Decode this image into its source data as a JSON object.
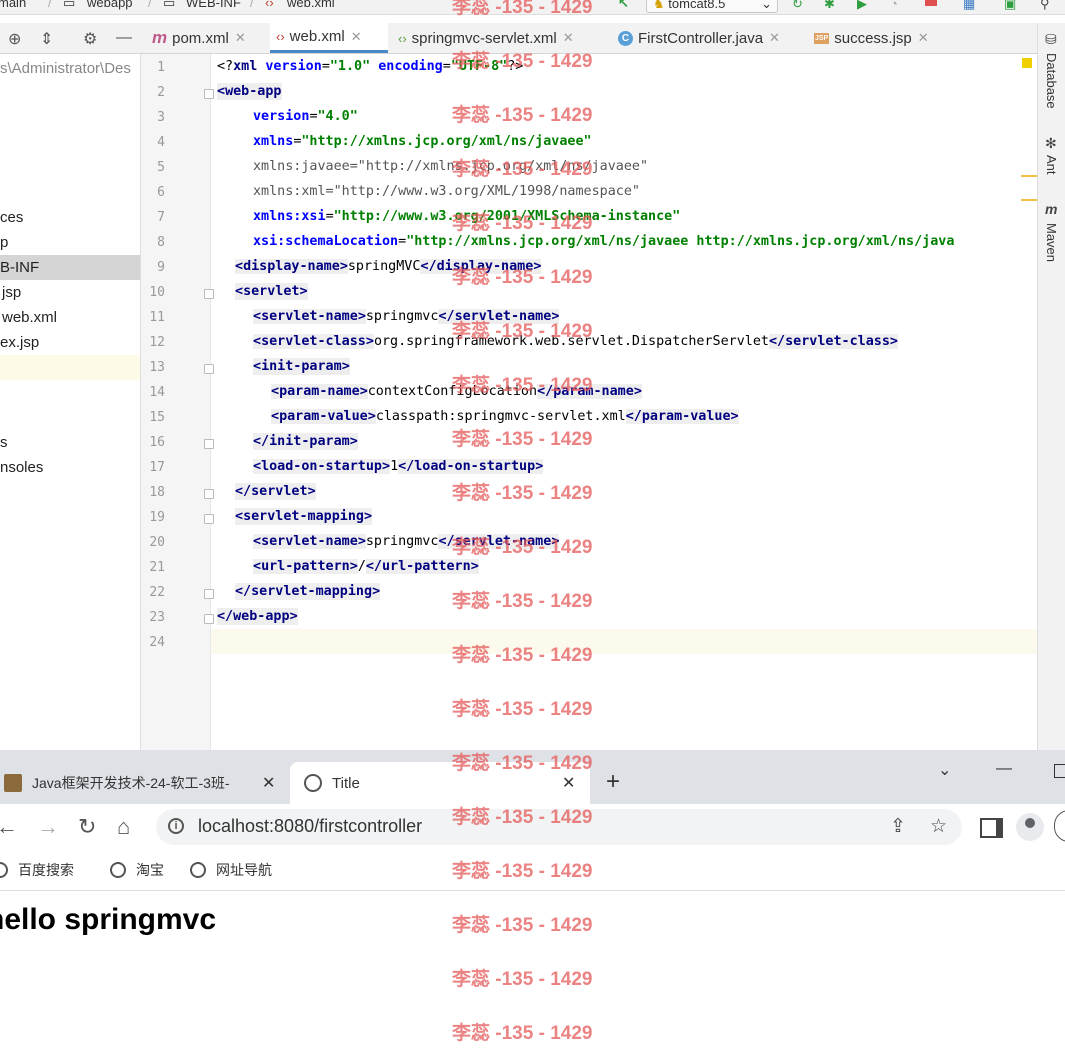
{
  "ide": {
    "breadcrumbs": [
      "main",
      "webapp",
      "WEB-INF",
      "web.xml"
    ],
    "run_config": "tomcat8.5",
    "tabs": [
      {
        "label": "pom.xml",
        "icon": "maven-icon",
        "active": false
      },
      {
        "label": "web.xml",
        "icon": "xml-file-icon",
        "active": true
      },
      {
        "label": "springmvc-servlet.xml",
        "icon": "spring-xml-icon",
        "active": false
      },
      {
        "label": "FirstController.java",
        "icon": "java-class-icon",
        "active": false
      },
      {
        "label": "success.jsp",
        "icon": "jsp-file-icon",
        "active": false
      }
    ],
    "project_tree": {
      "path": "s\\Administrator\\Des",
      "items": [
        "ces",
        "p",
        "B-INF",
        "jsp",
        "web.xml",
        "ex.jsp",
        "",
        "s",
        "nsoles"
      ]
    },
    "right_tools": [
      "Database",
      "Ant",
      "Maven"
    ],
    "line_numbers": [
      "1",
      "2",
      "3",
      "4",
      "5",
      "6",
      "7",
      "8",
      "9",
      "10",
      "11",
      "12",
      "13",
      "14",
      "15",
      "16",
      "17",
      "18",
      "19",
      "20",
      "21",
      "22",
      "23",
      "24"
    ],
    "code": {
      "l1": [
        "<?",
        "xml",
        " ",
        "version",
        "=",
        "\"1.0\"",
        " ",
        "encoding",
        "=",
        "\"UTF-8\"",
        "?>"
      ],
      "l2": [
        "<",
        "web-app"
      ],
      "l3": [
        "version",
        "=",
        "\"4.0\""
      ],
      "l4": [
        "xmlns",
        "=",
        "\"http://xmlns.jcp.org/xml/ns/javaee\""
      ],
      "l5": [
        "xmlns:javaee=\"http://xmlns.jcp.org/xml/ns/javaee\""
      ],
      "l6": [
        "xmlns:xml=\"http://www.w3.org/XML/1998/namespace\""
      ],
      "l7": [
        "xmlns:xsi",
        "=",
        "\"http://www.w3.org/2001/XMLSchema-instance\""
      ],
      "l8": [
        "xsi:schemaLocation",
        "=",
        "\"http://xmlns.jcp.org/xml/ns/javaee http://xmlns.jcp.org/xml/ns/java"
      ],
      "l9": [
        "<",
        "display-name",
        ">",
        "springMVC",
        "</",
        "display-name",
        ">"
      ],
      "l10": [
        "<",
        "servlet",
        ">"
      ],
      "l11": [
        "<",
        "servlet-name",
        ">",
        "springmvc",
        "</",
        "servlet-name",
        ">"
      ],
      "l12": [
        "<",
        "servlet-class",
        ">",
        "org.springframework.web.servlet.DispatcherServlet",
        "</",
        "servlet-class",
        ">"
      ],
      "l13": [
        "<",
        "init-param",
        ">"
      ],
      "l14": [
        "<",
        "param-name",
        ">",
        "contextConfigLocation",
        "</",
        "param-name",
        ">"
      ],
      "l15": [
        "<",
        "param-value",
        ">",
        "classpath:springmvc-servlet.xml",
        "</",
        "param-value",
        ">"
      ],
      "l16": [
        "</",
        "init-param",
        ">"
      ],
      "l17": [
        "<",
        "load-on-startup",
        ">",
        "1",
        "</",
        "load-on-startup",
        ">"
      ],
      "l18": [
        "</",
        "servlet",
        ">"
      ],
      "l19": [
        "<",
        "servlet-mapping",
        ">"
      ],
      "l20": [
        "<",
        "servlet-name",
        ">",
        "springmvc",
        "</",
        "servlet-name",
        ">"
      ],
      "l21": [
        "<",
        "url-pattern",
        ">",
        "/",
        "</",
        "url-pattern",
        ">"
      ],
      "l22": [
        "</",
        "servlet-mapping",
        ">"
      ],
      "l23": [
        "</",
        "web-app",
        ">"
      ]
    }
  },
  "browser": {
    "tabs": [
      {
        "title": "Java框架开发技术-24-软工-3班-",
        "active": false
      },
      {
        "title": "Title",
        "active": true
      }
    ],
    "new_tab": "+",
    "window_controls": {
      "minimize": "—",
      "chevron": "⌄"
    },
    "url": "localhost:8080/firstcontroller",
    "bookmarks": [
      "百度搜索",
      "淘宝",
      "网址导航"
    ],
    "heading": "hello springmvc"
  },
  "watermark": {
    "text": "李蕊 -135 - 1429",
    "color": "#e65a5a"
  },
  "colors": {
    "tag": "#000080",
    "attr": "#0000ff",
    "value": "#008000",
    "tab_underline": "#4a88c7",
    "browser_tabbar": "#dee1e6"
  }
}
